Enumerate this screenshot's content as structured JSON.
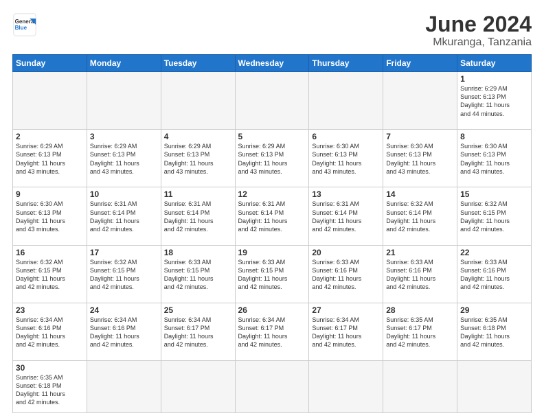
{
  "header": {
    "logo_general": "General",
    "logo_blue": "Blue",
    "title": "June 2024",
    "subtitle": "Mkuranga, Tanzania"
  },
  "days_of_week": [
    "Sunday",
    "Monday",
    "Tuesday",
    "Wednesday",
    "Thursday",
    "Friday",
    "Saturday"
  ],
  "weeks": [
    [
      {
        "day": "",
        "info": "",
        "empty": true
      },
      {
        "day": "",
        "info": "",
        "empty": true
      },
      {
        "day": "",
        "info": "",
        "empty": true
      },
      {
        "day": "",
        "info": "",
        "empty": true
      },
      {
        "day": "",
        "info": "",
        "empty": true
      },
      {
        "day": "",
        "info": "",
        "empty": true
      },
      {
        "day": "1",
        "info": "Sunrise: 6:29 AM\nSunset: 6:13 PM\nDaylight: 11 hours\nand 44 minutes."
      }
    ],
    [
      {
        "day": "2",
        "info": "Sunrise: 6:29 AM\nSunset: 6:13 PM\nDaylight: 11 hours\nand 43 minutes."
      },
      {
        "day": "3",
        "info": "Sunrise: 6:29 AM\nSunset: 6:13 PM\nDaylight: 11 hours\nand 43 minutes."
      },
      {
        "day": "4",
        "info": "Sunrise: 6:29 AM\nSunset: 6:13 PM\nDaylight: 11 hours\nand 43 minutes."
      },
      {
        "day": "5",
        "info": "Sunrise: 6:29 AM\nSunset: 6:13 PM\nDaylight: 11 hours\nand 43 minutes."
      },
      {
        "day": "6",
        "info": "Sunrise: 6:30 AM\nSunset: 6:13 PM\nDaylight: 11 hours\nand 43 minutes."
      },
      {
        "day": "7",
        "info": "Sunrise: 6:30 AM\nSunset: 6:13 PM\nDaylight: 11 hours\nand 43 minutes."
      },
      {
        "day": "8",
        "info": "Sunrise: 6:30 AM\nSunset: 6:13 PM\nDaylight: 11 hours\nand 43 minutes."
      }
    ],
    [
      {
        "day": "9",
        "info": "Sunrise: 6:30 AM\nSunset: 6:13 PM\nDaylight: 11 hours\nand 43 minutes."
      },
      {
        "day": "10",
        "info": "Sunrise: 6:31 AM\nSunset: 6:14 PM\nDaylight: 11 hours\nand 42 minutes."
      },
      {
        "day": "11",
        "info": "Sunrise: 6:31 AM\nSunset: 6:14 PM\nDaylight: 11 hours\nand 42 minutes."
      },
      {
        "day": "12",
        "info": "Sunrise: 6:31 AM\nSunset: 6:14 PM\nDaylight: 11 hours\nand 42 minutes."
      },
      {
        "day": "13",
        "info": "Sunrise: 6:31 AM\nSunset: 6:14 PM\nDaylight: 11 hours\nand 42 minutes."
      },
      {
        "day": "14",
        "info": "Sunrise: 6:32 AM\nSunset: 6:14 PM\nDaylight: 11 hours\nand 42 minutes."
      },
      {
        "day": "15",
        "info": "Sunrise: 6:32 AM\nSunset: 6:15 PM\nDaylight: 11 hours\nand 42 minutes."
      }
    ],
    [
      {
        "day": "16",
        "info": "Sunrise: 6:32 AM\nSunset: 6:15 PM\nDaylight: 11 hours\nand 42 minutes."
      },
      {
        "day": "17",
        "info": "Sunrise: 6:32 AM\nSunset: 6:15 PM\nDaylight: 11 hours\nand 42 minutes."
      },
      {
        "day": "18",
        "info": "Sunrise: 6:33 AM\nSunset: 6:15 PM\nDaylight: 11 hours\nand 42 minutes."
      },
      {
        "day": "19",
        "info": "Sunrise: 6:33 AM\nSunset: 6:15 PM\nDaylight: 11 hours\nand 42 minutes."
      },
      {
        "day": "20",
        "info": "Sunrise: 6:33 AM\nSunset: 6:16 PM\nDaylight: 11 hours\nand 42 minutes."
      },
      {
        "day": "21",
        "info": "Sunrise: 6:33 AM\nSunset: 6:16 PM\nDaylight: 11 hours\nand 42 minutes."
      },
      {
        "day": "22",
        "info": "Sunrise: 6:33 AM\nSunset: 6:16 PM\nDaylight: 11 hours\nand 42 minutes."
      }
    ],
    [
      {
        "day": "23",
        "info": "Sunrise: 6:34 AM\nSunset: 6:16 PM\nDaylight: 11 hours\nand 42 minutes."
      },
      {
        "day": "24",
        "info": "Sunrise: 6:34 AM\nSunset: 6:16 PM\nDaylight: 11 hours\nand 42 minutes."
      },
      {
        "day": "25",
        "info": "Sunrise: 6:34 AM\nSunset: 6:17 PM\nDaylight: 11 hours\nand 42 minutes."
      },
      {
        "day": "26",
        "info": "Sunrise: 6:34 AM\nSunset: 6:17 PM\nDaylight: 11 hours\nand 42 minutes."
      },
      {
        "day": "27",
        "info": "Sunrise: 6:34 AM\nSunset: 6:17 PM\nDaylight: 11 hours\nand 42 minutes."
      },
      {
        "day": "28",
        "info": "Sunrise: 6:35 AM\nSunset: 6:17 PM\nDaylight: 11 hours\nand 42 minutes."
      },
      {
        "day": "29",
        "info": "Sunrise: 6:35 AM\nSunset: 6:18 PM\nDaylight: 11 hours\nand 42 minutes."
      }
    ],
    [
      {
        "day": "30",
        "info": "Sunrise: 6:35 AM\nSunset: 6:18 PM\nDaylight: 11 hours\nand 42 minutes."
      },
      {
        "day": "",
        "info": "",
        "empty": true
      },
      {
        "day": "",
        "info": "",
        "empty": true
      },
      {
        "day": "",
        "info": "",
        "empty": true
      },
      {
        "day": "",
        "info": "",
        "empty": true
      },
      {
        "day": "",
        "info": "",
        "empty": true
      },
      {
        "day": "",
        "info": "",
        "empty": true
      }
    ]
  ]
}
